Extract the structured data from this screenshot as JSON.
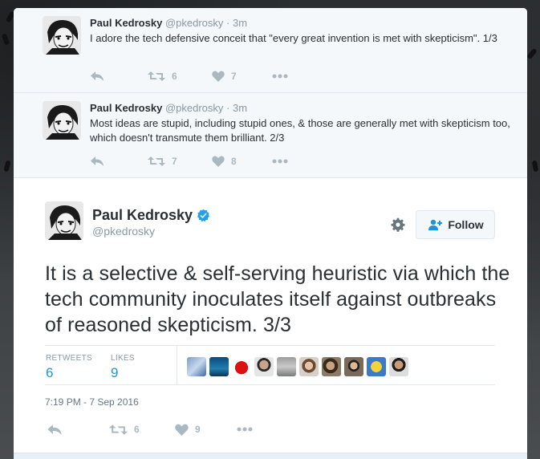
{
  "thread": [
    {
      "name": "Paul Kedrosky",
      "handle": "@pkedrosky",
      "separator": "·",
      "time": "3m",
      "text": "I adore the tech defensive conceit that \"every great invention is met with skepticism\". 1/3",
      "retweets": "6",
      "likes": "7"
    },
    {
      "name": "Paul Kedrosky",
      "handle": "@pkedrosky",
      "separator": "·",
      "time": "3m",
      "text": "Most ideas are stupid, including stupid ones, & those are generally met with skepticism too, which doesn't transmute them brilliant. 2/3",
      "retweets": "7",
      "likes": "8"
    }
  ],
  "focused": {
    "name": "Paul Kedrosky",
    "handle": "@pkedrosky",
    "follow_label": "Follow",
    "text": "It is a selective & self-serving heuristic via which the tech community inoculates itself against outbreaks of reasoned skepticism. 3/3",
    "stats": {
      "retweets_label": "RETWEETS",
      "retweets": "6",
      "likes_label": "LIKES",
      "likes": "9"
    },
    "timestamp": "7:19 PM - 7 Sep 2016",
    "action_retweets": "6",
    "action_likes": "9"
  },
  "icons": {
    "reply": "reply-icon",
    "retweet": "retweet-icon",
    "like": "heart-icon",
    "more": "more-icon",
    "verified": "verified-badge-icon",
    "settings": "gear-icon",
    "follow": "follow-person-icon"
  },
  "colors": {
    "accent": "#1b95e0",
    "verified": "#1da1f2",
    "muted": "#8899a6",
    "icon": "#aab8c2",
    "ancestor_bg": "#f5f8fa"
  },
  "likers": [
    "liker-1",
    "liker-2",
    "liker-3",
    "liker-4",
    "liker-5",
    "liker-6",
    "liker-7",
    "liker-8",
    "liker-9",
    "liker-10"
  ]
}
